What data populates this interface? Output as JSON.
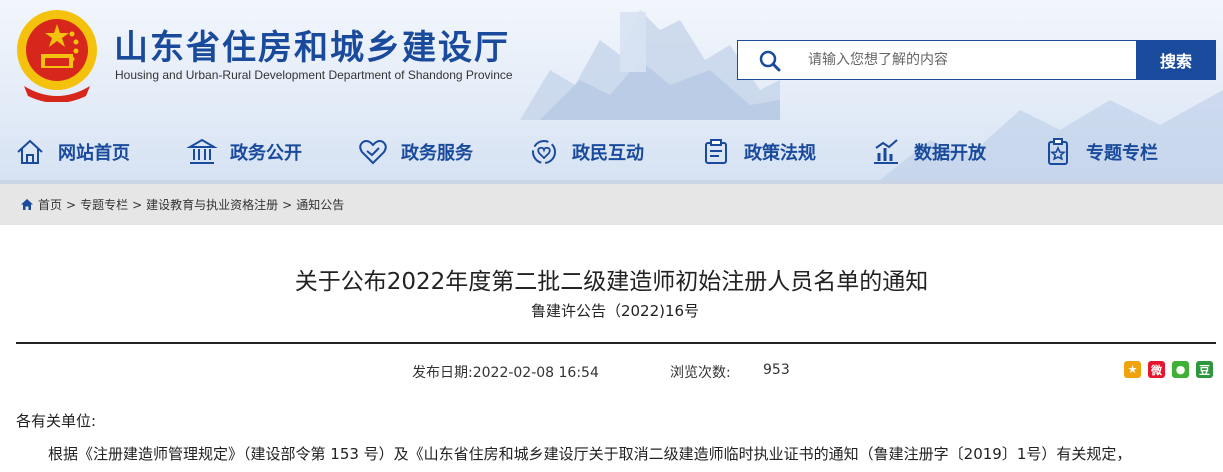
{
  "header": {
    "title": "山东省住房和城乡建设厅",
    "subtitle": "Housing and Urban-Rural Development Department of Shandong Province"
  },
  "search": {
    "placeholder": "请输入您想了解的内容",
    "button_label": "搜索"
  },
  "nav": {
    "items": [
      {
        "label": "网站首页",
        "icon": "home-icon"
      },
      {
        "label": "政务公开",
        "icon": "government-building-icon"
      },
      {
        "label": "政务服务",
        "icon": "handshake-heart-icon"
      },
      {
        "label": "政民互动",
        "icon": "interaction-icon"
      },
      {
        "label": "政策法规",
        "icon": "policy-document-icon"
      },
      {
        "label": "数据开放",
        "icon": "data-chart-icon"
      },
      {
        "label": "专题专栏",
        "icon": "special-topic-icon"
      }
    ]
  },
  "breadcrumb": {
    "items": [
      "首页",
      "专题专栏",
      "建设教育与执业资格注册",
      "通知公告"
    ],
    "separator": ">"
  },
  "article": {
    "title": "关于公布2022年度第二批二级建造师初始注册人员名单的通知",
    "doc_number": "鲁建许公告（2022)16号",
    "publish_label": "发布日期:2022-02-08 16:54",
    "views_label": "浏览次数:",
    "views": "953",
    "greeting": "各有关单位:",
    "paragraph": "根据《注册建造师管理规定》（建设部令第 153 号）及《山东省住房和城乡建设厅关于取消二级建造师临时执业证书的通知（鲁建注册字〔2019〕1号）有关规定，"
  },
  "share": {
    "items": [
      {
        "name": "qzone-share-icon",
        "color": "#f0a30a"
      },
      {
        "name": "weibo-share-icon",
        "color": "#e6162d"
      },
      {
        "name": "wechat-share-icon",
        "color": "#3eb135"
      },
      {
        "name": "douban-share-icon",
        "color": "#2e963d"
      }
    ]
  },
  "colors": {
    "brand": "#1a4a9c"
  }
}
